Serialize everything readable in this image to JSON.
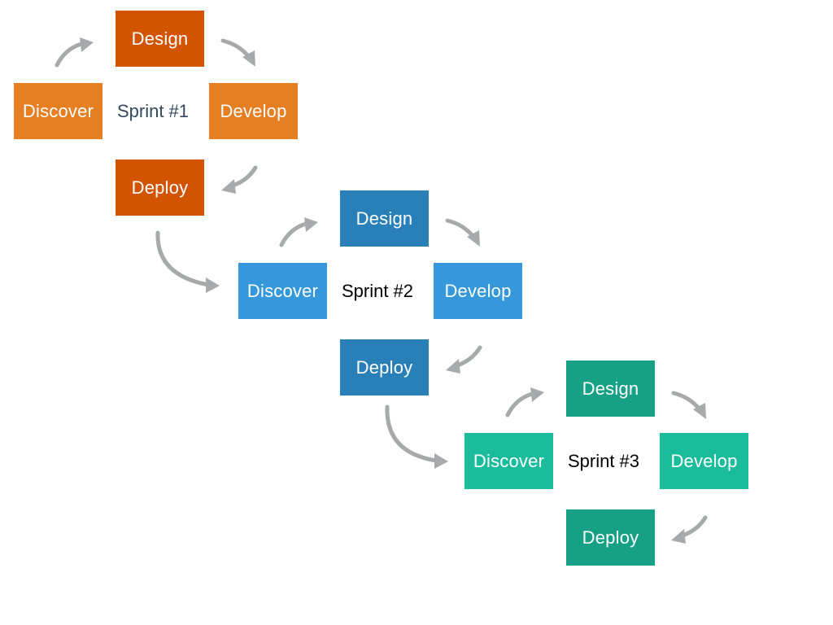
{
  "sprints": [
    {
      "label": "Sprint #1",
      "design": "Design",
      "discover": "Discover",
      "develop": "Develop",
      "deploy": "Deploy",
      "colors": {
        "dark": "#d35400",
        "light": "#e67e22",
        "label": "#34495e"
      }
    },
    {
      "label": "Sprint #2",
      "design": "Design",
      "discover": "Discover",
      "develop": "Develop",
      "deploy": "Deploy",
      "colors": {
        "dark": "#2980b9",
        "light": "#3498db",
        "label": "#000000"
      }
    },
    {
      "label": "Sprint #3",
      "design": "Design",
      "discover": "Discover",
      "develop": "Develop",
      "deploy": "Deploy",
      "colors": {
        "dark": "#16a085",
        "light": "#1abc9c",
        "label": "#000000"
      }
    }
  ],
  "arrow_color": "#a7a9ab"
}
